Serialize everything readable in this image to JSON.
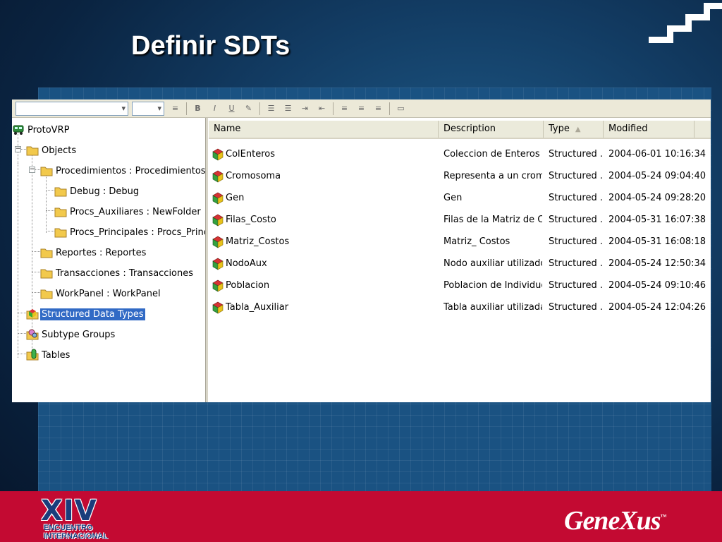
{
  "slide": {
    "title": "Definir SDTs"
  },
  "toolbar": {
    "icons": [
      "combo-box",
      "combo-box",
      "align-icon",
      "bold-icon",
      "italic-icon",
      "underline-icon",
      "tools-icon",
      "list-icon",
      "list-icon",
      "indent-icon",
      "outdent-icon",
      "align-left-icon",
      "align-center-icon",
      "align-right-icon",
      "window-icon"
    ]
  },
  "tree": {
    "items": [
      {
        "label": "ProtoVRP",
        "icon": "model-icon"
      },
      {
        "label": "Objects",
        "icon": "folder-icon"
      },
      {
        "label": "Procedimientos : Procedimientos",
        "icon": "folder-icon"
      },
      {
        "label": "Debug : Debug",
        "icon": "folder-icon"
      },
      {
        "label": "Procs_Auxiliares : NewFolder",
        "icon": "folder-icon"
      },
      {
        "label": "Procs_Principales : Procs_Principales",
        "icon": "folder-icon"
      },
      {
        "label": "Reportes : Reportes",
        "icon": "folder-icon"
      },
      {
        "label": "Transacciones : Transacciones",
        "icon": "folder-icon"
      },
      {
        "label": "WorkPanel : WorkPanel",
        "icon": "folder-icon"
      },
      {
        "label": "Structured Data Types",
        "icon": "sdt-folder-icon",
        "selected": true
      },
      {
        "label": "Subtype Groups",
        "icon": "subtype-icon"
      },
      {
        "label": "Tables",
        "icon": "table-icon"
      }
    ]
  },
  "list": {
    "columns": {
      "name": "Name",
      "description": "Description",
      "type": "Type",
      "modified": "Modified"
    },
    "sort_icon": "sort-ascending-icon",
    "rows": [
      {
        "name": "ColEnteros",
        "description": "Coleccion de Enteros",
        "type": "Structured ...",
        "modified": "2004-06-01 10:16:34"
      },
      {
        "name": "Cromosoma",
        "description": "Representa a un cromo...",
        "type": "Structured ...",
        "modified": "2004-05-24 09:04:40"
      },
      {
        "name": "Gen",
        "description": "Gen",
        "type": "Structured ...",
        "modified": "2004-05-24 09:28:20"
      },
      {
        "name": "Filas_Costo",
        "description": "Filas de la Matriz de Costo",
        "type": "Structured ...",
        "modified": "2004-05-31 16:07:38"
      },
      {
        "name": "Matriz_Costos",
        "description": "Matriz_ Costos",
        "type": "Structured ...",
        "modified": "2004-05-31 16:08:18"
      },
      {
        "name": "NodoAux",
        "description": "Nodo auxiliar utilizado p...",
        "type": "Structured ...",
        "modified": "2004-05-24 12:50:34"
      },
      {
        "name": "Poblacion",
        "description": "Poblacion de Individuos",
        "type": "Structured ...",
        "modified": "2004-05-24 09:10:46"
      },
      {
        "name": "Tabla_Auxiliar",
        "description": "Tabla auxiliar utilizada p...",
        "type": "Structured ...",
        "modified": "2004-05-24 12:04:26"
      }
    ]
  },
  "footer": {
    "event_logo": {
      "numeral": "XIV",
      "line1": "ENCUENTRO",
      "line2": "INTERNACIONAL"
    },
    "brand_logo": {
      "text": "GeneXus",
      "mark": "™"
    }
  },
  "colors": {
    "background": "#0a2340",
    "selection": "#316ac5",
    "footer": "#c30a32"
  }
}
